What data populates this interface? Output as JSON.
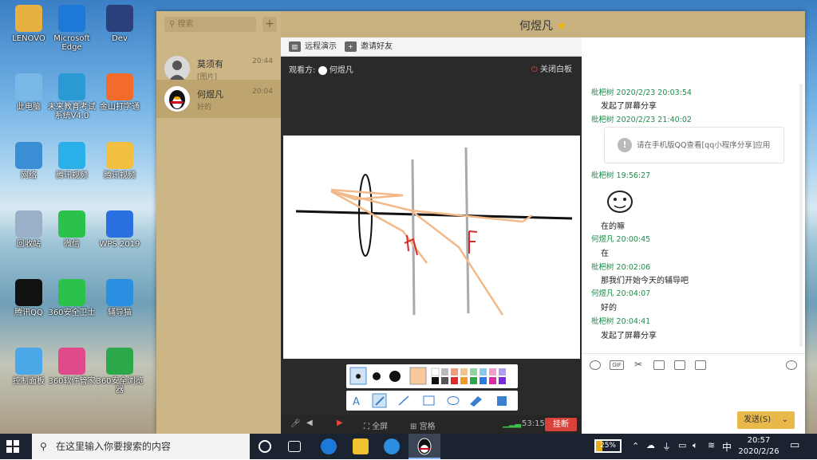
{
  "desktop_icons": [
    {
      "label": "LENOVO",
      "icon": "folder-user-icon"
    },
    {
      "label": "Microsoft Edge",
      "icon": "edge-icon"
    },
    {
      "label": "Dev",
      "icon": "dev-icon"
    },
    {
      "label": "此电脑",
      "icon": "this-pc-icon"
    },
    {
      "label": "未来教育考试系统V4.0",
      "icon": "exam-system-icon"
    },
    {
      "label": "金山打字通",
      "icon": "typing-icon"
    },
    {
      "label": "网络",
      "icon": "network-icon"
    },
    {
      "label": "腾讯视频",
      "icon": "tencent-video-icon"
    },
    {
      "label": "腾讯视频",
      "icon": "video-folder-icon"
    },
    {
      "label": "回收站",
      "icon": "recycle-bin-icon"
    },
    {
      "label": "微信",
      "icon": "wechat-icon"
    },
    {
      "label": "WPS 2019",
      "icon": "wps-icon"
    },
    {
      "label": "腾讯QQ",
      "icon": "qq-icon"
    },
    {
      "label": "360安全卫士",
      "icon": "360-guard-icon"
    },
    {
      "label": "辅导猫",
      "icon": "tutor-cat-icon"
    },
    {
      "label": "控制面板",
      "icon": "control-panel-icon"
    },
    {
      "label": "360软件管家",
      "icon": "360-software-icon"
    },
    {
      "label": "360安全浏览器",
      "icon": "360-browser-icon"
    }
  ],
  "qq": {
    "search_placeholder": "搜索",
    "add_symbol": "+",
    "contacts": [
      {
        "name": "莫须有",
        "preview": "[图片]",
        "time": "20:44"
      },
      {
        "name": "何煜凡",
        "preview": "好的",
        "time": "20:04"
      }
    ],
    "chat_title": "何煜凡",
    "share": {
      "remote_demo": "远程演示",
      "invite": "邀请好友",
      "viewer_label": "观看方:",
      "viewer_name": "何煜凡",
      "close_whiteboard": "关闭白板",
      "fullscreen": "全屏",
      "grid": "宫格",
      "duration": "53:15",
      "hangup": "挂断"
    },
    "messages": [
      {
        "sender": "枇杷树",
        "time": "2020/2/23 20:03:54",
        "text": "发起了屏幕分享"
      },
      {
        "sender": "枇杷树",
        "time": "2020/2/23 21:40:02",
        "text": "请在手机版QQ查看[qq小程序分享]应用"
      },
      {
        "sender": "枇杷树",
        "time": "19:56:27",
        "text": "在的嘛"
      },
      {
        "sender": "何煜凡",
        "time": "20:00:45",
        "text": "在"
      },
      {
        "sender": "枇杷树",
        "time": "20:02:06",
        "text": "那我们开始今天的辅导吧"
      },
      {
        "sender": "何煜凡",
        "time": "20:04:07",
        "text": "好的"
      },
      {
        "sender": "枇杷树",
        "time": "20:04:41",
        "text": "发起了屏幕分享"
      }
    ],
    "send_label": "发送(S)",
    "gif_label": "GIF"
  },
  "taskbar": {
    "search_placeholder": "在这里输入你要搜索的内容",
    "battery": "25%",
    "battery_level": 0.25,
    "ime": "中",
    "time": "20:57",
    "date": "2020/2/26"
  },
  "colors": {
    "sidebar": "#cdb686",
    "header": "#c9b07f",
    "send": "#e9b84a",
    "hangup": "#d9423a",
    "meta_green": "#1c8c4a"
  }
}
